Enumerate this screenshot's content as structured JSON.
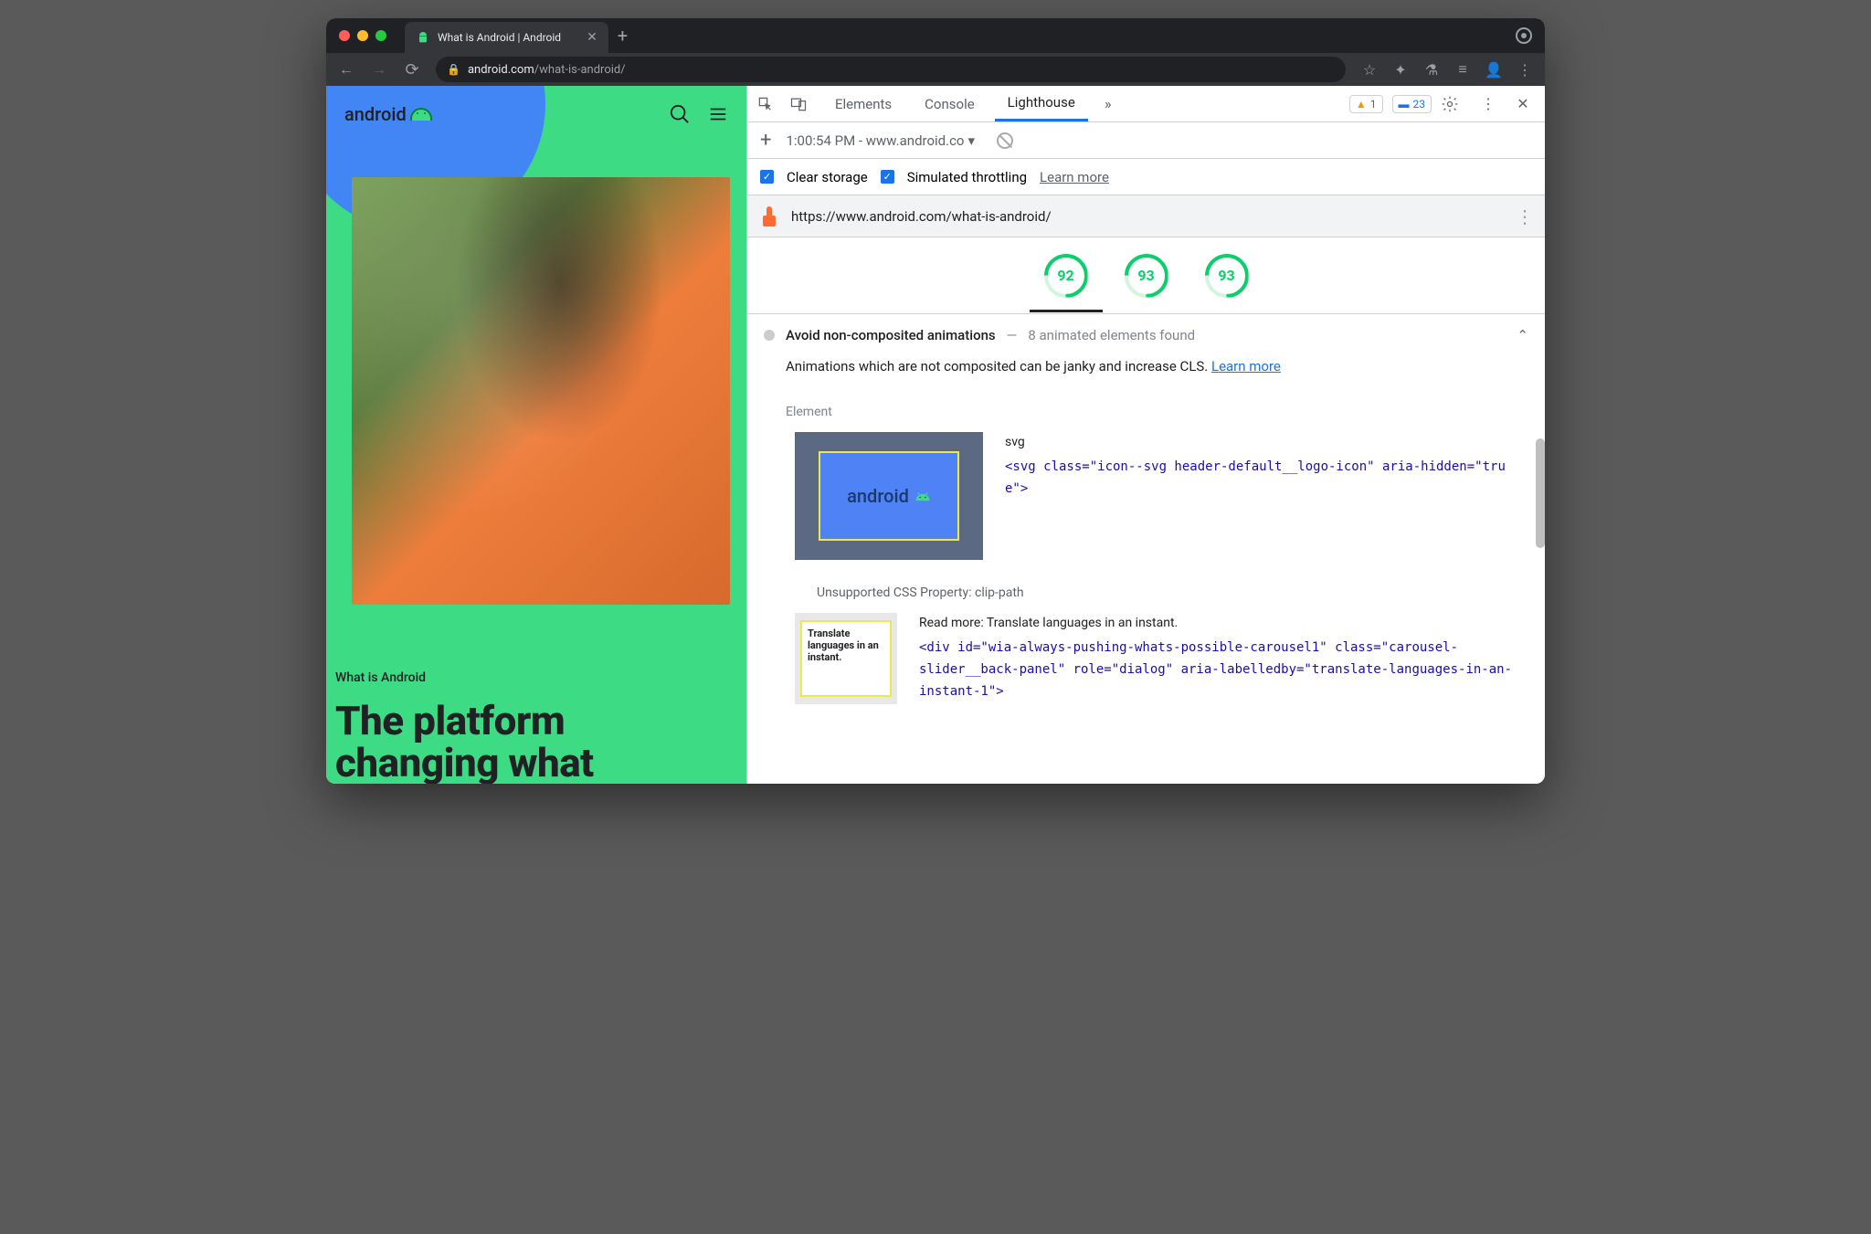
{
  "browser": {
    "tab_title": "What is Android | Android",
    "url_domain": "android.com",
    "url_path": "/what-is-android/"
  },
  "page": {
    "logo": "android",
    "eyebrow": "What is Android",
    "heading": "The platform changing what"
  },
  "devtools": {
    "tabs": {
      "elements": "Elements",
      "console": "Console",
      "lighthouse": "Lighthouse"
    },
    "badges": {
      "warnings": "1",
      "info": "23"
    },
    "report_time": "1:00:54 PM - www.android.co",
    "clear_storage": "Clear storage",
    "sim_throttle": "Simulated throttling",
    "learn_more": "Learn more",
    "audited_url": "https://www.android.com/what-is-android/",
    "scores": [
      "92",
      "93",
      "93"
    ],
    "audit": {
      "title": "Avoid non-composited animations",
      "sep": "—",
      "sub": "8 animated elements found",
      "desc_pre": "Animations which are not composited can be janky and increase CLS. ",
      "desc_link": "Learn more",
      "element_label": "Element",
      "el1_tag": "svg",
      "el1_html": "<svg class=\"icon--svg header-default__logo-icon\" aria-hidden=\"true\">",
      "thumb1_text": "android",
      "unsupported": "Unsupported CSS Property: clip-path",
      "el2_read": "Read more: Translate languages in an instant.",
      "el2_html": "<div id=\"wia-always-pushing-whats-possible-carousel1\" class=\"carousel-slider__back-panel\" role=\"dialog\" aria-labelledby=\"translate-languages-in-an-instant-1\">",
      "thumb2_text": "Translate languages in an instant."
    }
  }
}
